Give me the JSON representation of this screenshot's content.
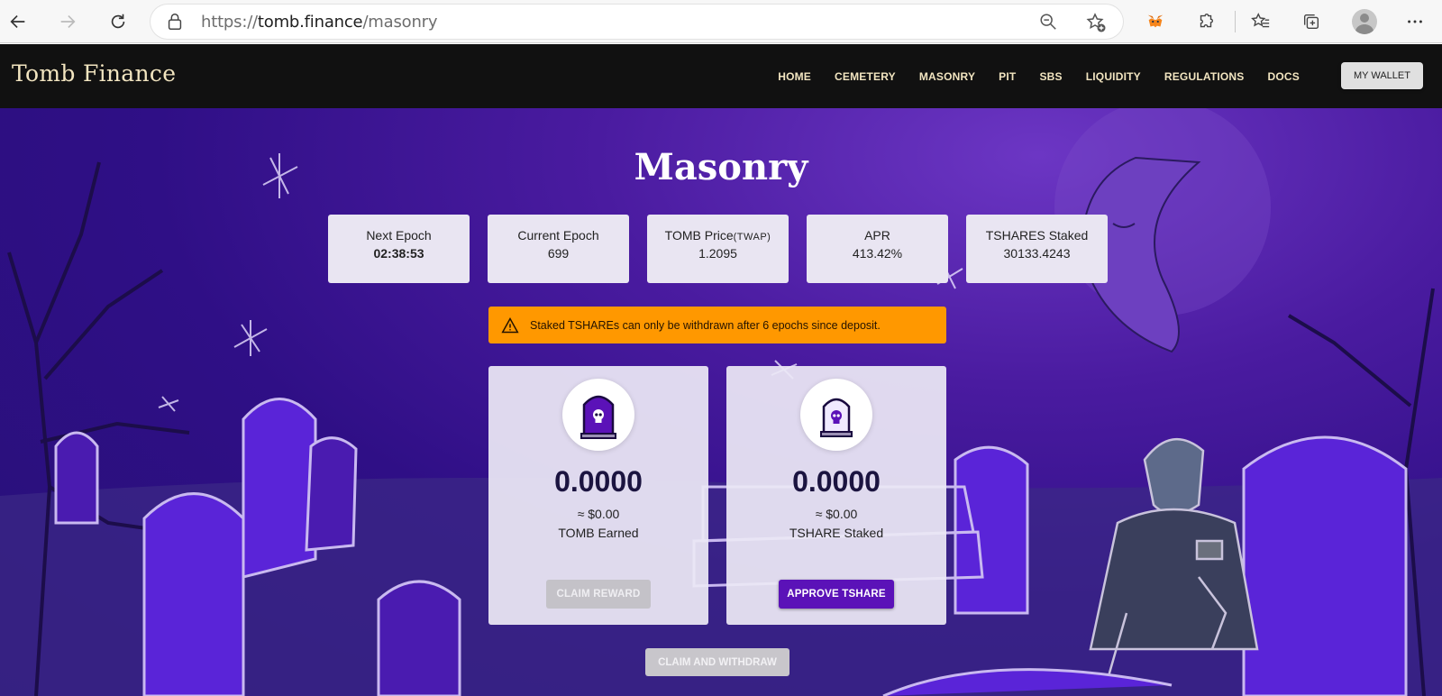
{
  "browser": {
    "url_prefix": "https://",
    "url_domain": "tomb.finance",
    "url_path": "/masonry",
    "icons": [
      "back-icon",
      "forward-icon",
      "refresh-icon",
      "lock-icon",
      "zoom-out-icon",
      "add-favorite-icon",
      "metamask-icon",
      "extensions-icon",
      "favorites-icon",
      "collections-icon",
      "profile-icon",
      "more-icon"
    ]
  },
  "site": {
    "brand": "Tomb Finance",
    "nav": [
      "HOME",
      "CEMETERY",
      "MASONRY",
      "PIT",
      "SBS",
      "LIQUIDITY",
      "REGULATIONS",
      "DOCS"
    ],
    "wallet_button": "MY WALLET"
  },
  "page": {
    "title": "Masonry",
    "stats": [
      {
        "label": "Next Epoch",
        "value": "02:38:53"
      },
      {
        "label": "Current Epoch",
        "value": "699"
      },
      {
        "label": "TOMB Price",
        "label_suffix": "(TWAP)",
        "value": "1.2095"
      },
      {
        "label": "APR",
        "value": "413.42%"
      },
      {
        "label": "TSHARES Staked",
        "value": "30133.4243"
      }
    ],
    "alert": "Staked TSHAREs can only be withdrawn after 6 epochs since deposit.",
    "cards": [
      {
        "amount": "0.0000",
        "usd": "≈ $0.00",
        "desc": "TOMB Earned",
        "button": "CLAIM REWARD"
      },
      {
        "amount": "0.0000",
        "usd": "≈ $0.00",
        "desc": "TSHARE Staked",
        "button": "APPROVE TSHARE"
      }
    ],
    "claim_withdraw": "CLAIM AND WITHDRAW"
  },
  "colors": {
    "nav_bg": "#111111",
    "nav_text": "#f2e5c0",
    "page_bg": "#3a1593",
    "alert_bg": "#ff9800",
    "primary_button": "#5b12b8"
  }
}
